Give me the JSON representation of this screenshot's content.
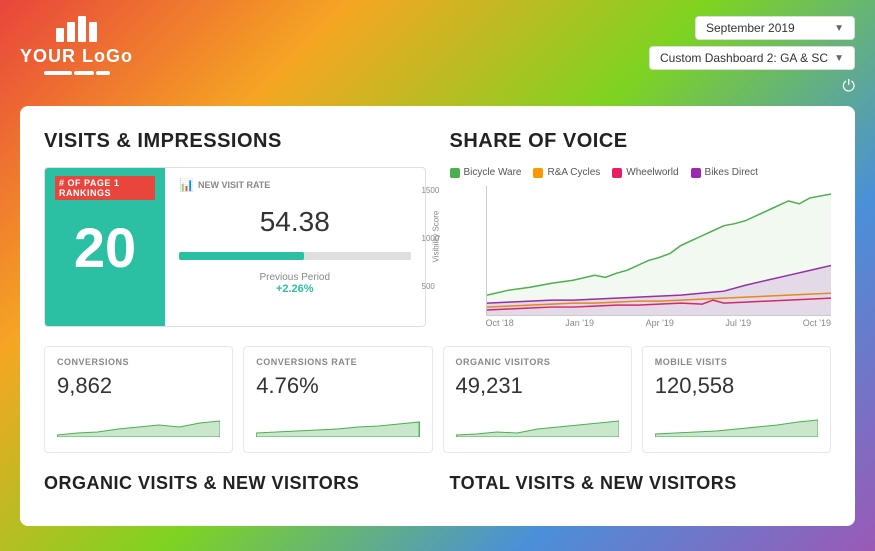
{
  "header": {
    "logo_text": "YOUR LoGo",
    "dropdown_date": "September 2019",
    "dropdown_dashboard": "Custom Dashboard 2: GA & SC",
    "power_icon": "⏻"
  },
  "visits_impressions": {
    "title": "VISITS & IMPRESSIONS",
    "rankings_label": "# OF PAGE 1 RANKINGS",
    "rankings_value": "20",
    "visit_rate_label": "NEW VISIT RATE",
    "visit_rate_value": "54.38",
    "progress_percent": 54,
    "previous_label": "Previous Period",
    "previous_value": "+2.26%"
  },
  "share_of_voice": {
    "title": "SHARE OF VOICE",
    "legend": [
      {
        "label": "Bicycle Ware",
        "color": "#4caf50"
      },
      {
        "label": "R&A Cycles",
        "color": "#ff9800"
      },
      {
        "label": "Wheelworld",
        "color": "#e91e63"
      },
      {
        "label": "Bikes Direct",
        "color": "#9c27b0"
      }
    ],
    "y_labels": [
      "1500",
      "1000",
      "500",
      ""
    ],
    "x_labels": [
      "Oct '18",
      "Jan '19",
      "Apr '19",
      "Jul '19",
      "Oct '19"
    ]
  },
  "stats": [
    {
      "label": "CONVERSIONS",
      "value": "9,862"
    },
    {
      "label": "CONVERSIONS RATE",
      "value": "4.76%"
    },
    {
      "label": "ORGANIC VISITORS",
      "value": "49,231"
    },
    {
      "label": "MOBILE VISITS",
      "value": "120,558"
    }
  ],
  "bottom_sections": [
    {
      "title": "ORGANIC VISITS & NEW VISITORS"
    },
    {
      "title": "TOTAL VISITS & NEW VISITORS"
    }
  ]
}
